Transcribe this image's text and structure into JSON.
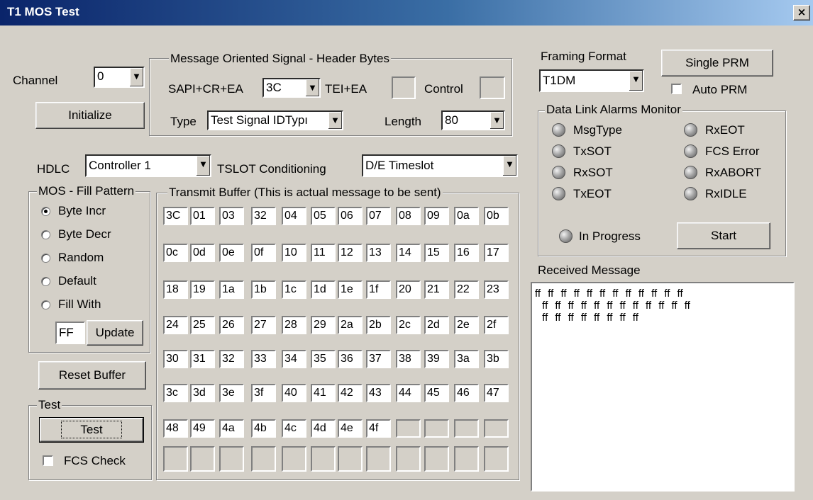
{
  "window": {
    "title": "T1 MOS Test",
    "close_glyph": "×"
  },
  "channel": {
    "label": "Channel",
    "value": "0"
  },
  "initialize_label": "Initialize",
  "header_bytes": {
    "title": "Message Oriented Signal - Header Bytes",
    "sapi_label": "SAPI+CR+EA",
    "sapi_value": "3C",
    "tei_label": "TEI+EA",
    "tei_value": "",
    "control_label": "Control",
    "control_value": "",
    "type_label": "Type",
    "type_value": "Test Signal IDTypı",
    "length_label": "Length",
    "length_value": "80"
  },
  "hdlc": {
    "label": "HDLC",
    "value": "Controller 1"
  },
  "tslot": {
    "label": "TSLOT Conditioning",
    "value": "D/E Timeslot"
  },
  "fill_pattern": {
    "title": "MOS - Fill Pattern",
    "options": [
      "Byte Incr",
      "Byte Decr",
      "Random",
      "Default",
      "Fill With"
    ],
    "selected": 0,
    "fill_value": "FF",
    "update_label": "Update"
  },
  "reset_buffer_label": "Reset Buffer",
  "test_group": {
    "title": "Test",
    "button_label": "Test",
    "fcs_label": "FCS Check",
    "fcs_checked": false
  },
  "transmit_buffer": {
    "title": "Transmit Buffer (This is actual message to be sent)",
    "rows": [
      [
        "3C",
        "01",
        "03",
        "32",
        "04",
        "05",
        "06",
        "07",
        "08",
        "09",
        "0a",
        "0b"
      ],
      [
        "0c",
        "0d",
        "0e",
        "0f",
        "10",
        "11",
        "12",
        "13",
        "14",
        "15",
        "16",
        "17"
      ],
      [
        "18",
        "19",
        "1a",
        "1b",
        "1c",
        "1d",
        "1e",
        "1f",
        "20",
        "21",
        "22",
        "23"
      ],
      [
        "24",
        "25",
        "26",
        "27",
        "28",
        "29",
        "2a",
        "2b",
        "2c",
        "2d",
        "2e",
        "2f"
      ],
      [
        "30",
        "31",
        "32",
        "33",
        "34",
        "35",
        "36",
        "37",
        "38",
        "39",
        "3a",
        "3b"
      ],
      [
        "3c",
        "3d",
        "3e",
        "3f",
        "40",
        "41",
        "42",
        "43",
        "44",
        "45",
        "46",
        "47"
      ],
      [
        "48",
        "49",
        "4a",
        "4b",
        "4c",
        "4d",
        "4e",
        "4f",
        "",
        "",
        "",
        ""
      ],
      [
        "",
        "",
        "",
        "",
        "",
        "",
        "",
        "",
        "",
        "",
        "",
        ""
      ]
    ]
  },
  "framing": {
    "label": "Framing Format",
    "value": "T1DM"
  },
  "single_prm_label": "Single PRM",
  "auto_prm": {
    "label": "Auto PRM",
    "checked": false
  },
  "alarms": {
    "title": "Data Link Alarms Monitor",
    "left": [
      "MsgType",
      "TxSOT",
      "RxSOT",
      "TxEOT"
    ],
    "right": [
      "RxEOT",
      "FCS Error",
      "RxABORT",
      "RxIDLE"
    ],
    "in_progress_label": "In Progress",
    "start_label": "Start"
  },
  "received": {
    "label": "Received Message",
    "text": "ff ff ff ff ff ff ff ff ff ff ff ff\n ff ff ff ff ff ff ff ff ff ff ff ff\n ff ff ff ff ff ff ff ff"
  },
  "colors": {
    "face": "#d4d0c8",
    "title_start": "#0a246a",
    "title_end": "#a6caf0"
  }
}
